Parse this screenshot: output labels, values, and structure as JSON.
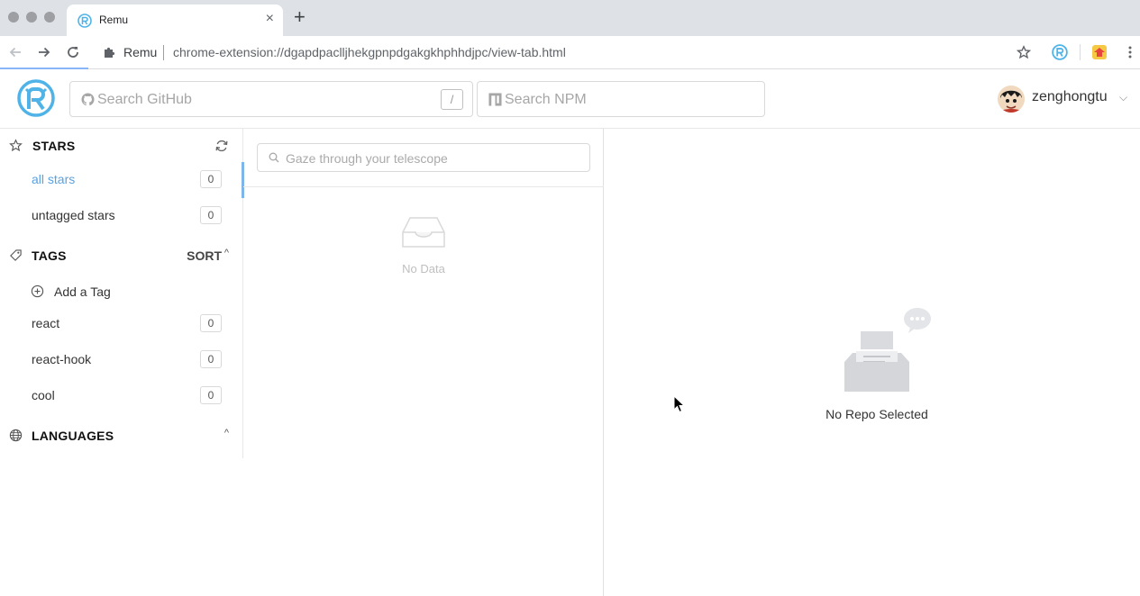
{
  "browser": {
    "tab_title": "Remu",
    "tab_close": "×",
    "new_tab": "+",
    "site_label": "Remu",
    "url": "chrome-extension://dgapdpaclljhekgpnpdgakgkhphhdjpc/view-tab.html"
  },
  "header": {
    "search_github_placeholder": "Search GitHub",
    "search_github_shortcut": "/",
    "search_npm_placeholder": "Search NPM",
    "username": "zenghongtu",
    "user_caret": "⌵"
  },
  "sidebar": {
    "stars": {
      "title": "STARS",
      "items": [
        {
          "label": "all stars",
          "count": "0",
          "active": true
        },
        {
          "label": "untagged stars",
          "count": "0",
          "active": false
        }
      ]
    },
    "tags": {
      "title": "TAGS",
      "sort_label": "SORT",
      "caret": "^",
      "add_label": "Add a Tag",
      "items": [
        {
          "label": "react",
          "count": "0"
        },
        {
          "label": "react-hook",
          "count": "0"
        },
        {
          "label": "cool",
          "count": "0"
        }
      ]
    },
    "languages": {
      "title": "LANGUAGES",
      "caret": "^"
    }
  },
  "list": {
    "search_placeholder": "Gaze through your telescope",
    "empty_text": "No Data"
  },
  "detail": {
    "empty_text": "No Repo Selected"
  },
  "colors": {
    "accent": "#5aa2e0",
    "logo": "#4fb3e8",
    "chrome_bg": "#dee1e6"
  }
}
